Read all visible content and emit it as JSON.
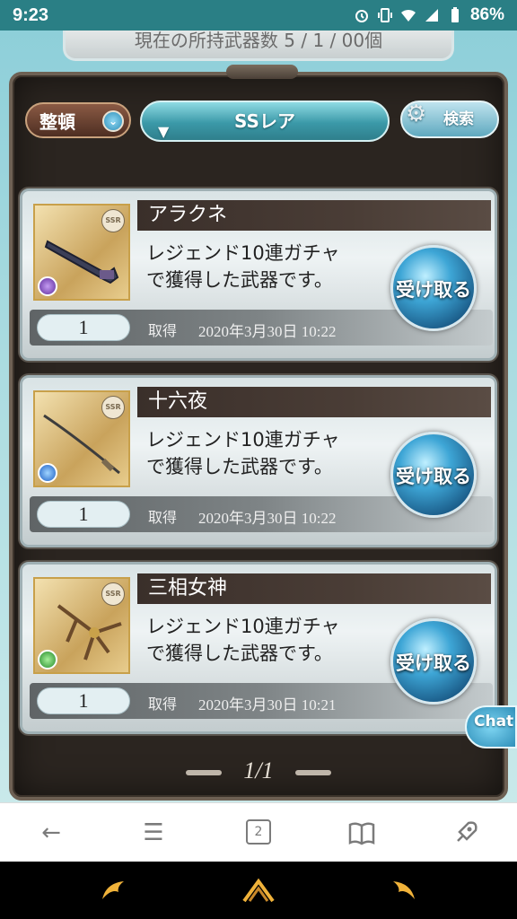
{
  "status_bar": {
    "time": "9:23",
    "battery": "86%",
    "icons": [
      "alarm-icon",
      "vibrate-icon",
      "wifi-icon",
      "signal-icon",
      "battery-icon"
    ]
  },
  "banner": {
    "text": "現在の所持武器数 5 / 1 / 00個"
  },
  "controls": {
    "sort_label": "整頓",
    "filter_label": "SSレア",
    "search_label": "検索"
  },
  "items": [
    {
      "name": "アラクネ",
      "rarity": "SSR",
      "element": "dark",
      "desc_line1": "レジェンド10連ガチャ",
      "desc_line2": "で獲得した武器です。",
      "quantity": "1",
      "acquired_label": "取得",
      "acquired_date": "2020年3月30日 10:22",
      "receive_label": "受け取る"
    },
    {
      "name": "十六夜",
      "rarity": "SSR",
      "element": "water",
      "desc_line1": "レジェンド10連ガチャ",
      "desc_line2": "で獲得した武器です。",
      "quantity": "1",
      "acquired_label": "取得",
      "acquired_date": "2020年3月30日 10:22",
      "receive_label": "受け取る"
    },
    {
      "name": "三相女神",
      "rarity": "SSR",
      "element": "wind",
      "desc_line1": "レジェンド10連ガチャ",
      "desc_line2": "で獲得した武器です。",
      "quantity": "1",
      "acquired_label": "取得",
      "acquired_date": "2020年3月30日 10:21",
      "receive_label": "受け取る"
    }
  ],
  "pager": {
    "text": "1/1"
  },
  "chat": {
    "label": "Chat"
  },
  "browser_toolbar": {
    "tab_count": "2",
    "icons": [
      "back-icon",
      "menu-icon",
      "tabs-icon",
      "bookmarks-icon",
      "rocket-icon"
    ]
  },
  "game_nav": {
    "icons": [
      "left-nav-icon",
      "home-nav-icon",
      "right-nav-icon"
    ]
  },
  "colors": {
    "status_bar": "#2a7f85",
    "accent_blue": "#3ea6d6",
    "panel_bg": "#2b2520"
  }
}
